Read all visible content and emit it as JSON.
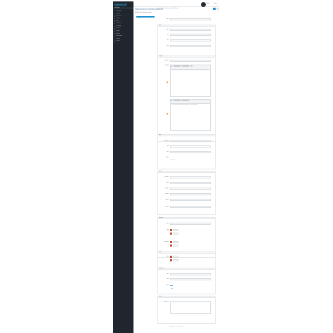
{
  "app": {
    "logo": "opencart",
    "nav_heading": "Navigation"
  },
  "sidebar": {
    "items": [
      {
        "label": "Dashboard"
      },
      {
        "label": "Catalog"
      },
      {
        "label": "Extensions"
      },
      {
        "label": "Design"
      },
      {
        "label": "Sales"
      },
      {
        "label": "Customers"
      },
      {
        "label": "Marketing"
      },
      {
        "label": "System"
      },
      {
        "label": "Reports"
      },
      {
        "label": "Settings"
      },
      {
        "label": "Maintenance"
      },
      {
        "label": "Modules"
      },
      {
        "label": "Layouts"
      }
    ]
  },
  "header": {
    "user": "Admin",
    "logout": "Logout"
  },
  "page": {
    "title": "Maintenance Mode Advance",
    "breadcrumb": "Home / Extensions / Maintenance Mode Advance",
    "info": "Edit Maintenance Mode Advance Module"
  },
  "tabs": [
    {
      "label": "General",
      "active": true
    },
    {
      "label": "Design"
    },
    {
      "label": "Social Links"
    },
    {
      "label": "Subscribe"
    }
  ],
  "general": {
    "status_label": "Status",
    "status_value": "Enabled",
    "title_label": "Title",
    "title_value": "Site under maintenance",
    "desc_label": "Message",
    "desc_text": "We are currently performing scheduled maintenance. We should be back shortly. Thank you for your patience.",
    "desc2_text": "We are currently performing scheduled maintenance. We will be back shortly."
  },
  "page_section": {
    "legend": "Page",
    "name_label": "Name",
    "name_value": "Maintenance",
    "url_label": "URL",
    "url_value": "http://example.com/",
    "date_label": "Date",
    "date_value": "2017-01-01"
  },
  "lang_section": {
    "legend": "Language",
    "text_label": "Text Editor",
    "text_value": "Enabled"
  },
  "style_section": {
    "legend": "Style",
    "bg_label": "Background",
    "bg_value": "Enabled",
    "color_label": "Color",
    "color_value": "#FFF",
    "size_label": "Size",
    "size_value": "",
    "image_label": "Image",
    "image_link": "Upload image"
  },
  "social_section": {
    "legend": "Social",
    "fb_label": "Facebook",
    "fb_value": "Enabled",
    "tw_label": "Twitter",
    "tw_value": "http://twitter.com/",
    "gp_label": "Google+",
    "gp_value": "http://plus.google.com/",
    "yt_label": "YouTube",
    "yt_value": "http://youtube.com/",
    "in_label": "LinkedIn",
    "in_value": "",
    "pi_label": "Pinterest",
    "pi_value": "http://pinterest.com/"
  },
  "subscribe_section": {
    "legend": "Subscribe",
    "status_label": "Status",
    "status_value": "Enabled",
    "logo_label": "Logo",
    "logo_value": "Upload",
    "bg_label": "Background",
    "bg_value": "Upload"
  },
  "extra_section": {
    "legend": "Banner",
    "img_label": "Image",
    "img_value": "Upload"
  },
  "countdown_section": {
    "legend": "Countdown",
    "date_label": "Date",
    "date_value": "2017-01-01",
    "time_label": "Time",
    "time_value": "00:00",
    "show_label": "Show"
  },
  "custom_section": {
    "legend": "Custom",
    "css_label": "Custom CSS",
    "css_value": ""
  },
  "footer": {
    "text": "OpenCart © 2017 All Rights Reserved."
  }
}
